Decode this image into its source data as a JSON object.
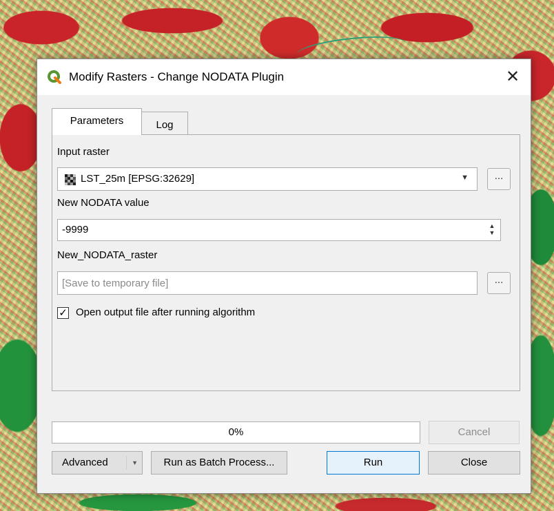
{
  "dialog": {
    "title": "Modify Rasters - Change NODATA Plugin",
    "close_glyph": "✕"
  },
  "tabs": [
    {
      "label": "Parameters",
      "active": true
    },
    {
      "label": "Log",
      "active": false
    }
  ],
  "params": {
    "input_raster_label": "Input raster",
    "input_raster_value": "LST_25m [EPSG:32629]",
    "nodata_label": "New NODATA value",
    "nodata_value": "-9999",
    "output_label": "New_NODATA_raster",
    "output_placeholder": "[Save to temporary file]",
    "browse_label": "...",
    "output_browse_label": "...",
    "open_output_label": "Open output file after running algorithm",
    "open_output_checked": true
  },
  "progress": {
    "text": "0%",
    "fraction": 0
  },
  "buttons": {
    "cancel": "Cancel",
    "advanced": "Advanced",
    "batch": "Run as Batch Process...",
    "run": "Run",
    "close": "Close"
  },
  "icons": {
    "app": "qgis-logo-icon",
    "raster": "raster-layer-icon",
    "combo_arrow": "chevron-down-icon",
    "spin": "spinner-arrows-icon"
  },
  "colors": {
    "dialog_bg": "#f0f0f0",
    "default_button_border": "#0078d7",
    "qgis_green": "#589632",
    "qgis_yellow": "#ee7913"
  }
}
